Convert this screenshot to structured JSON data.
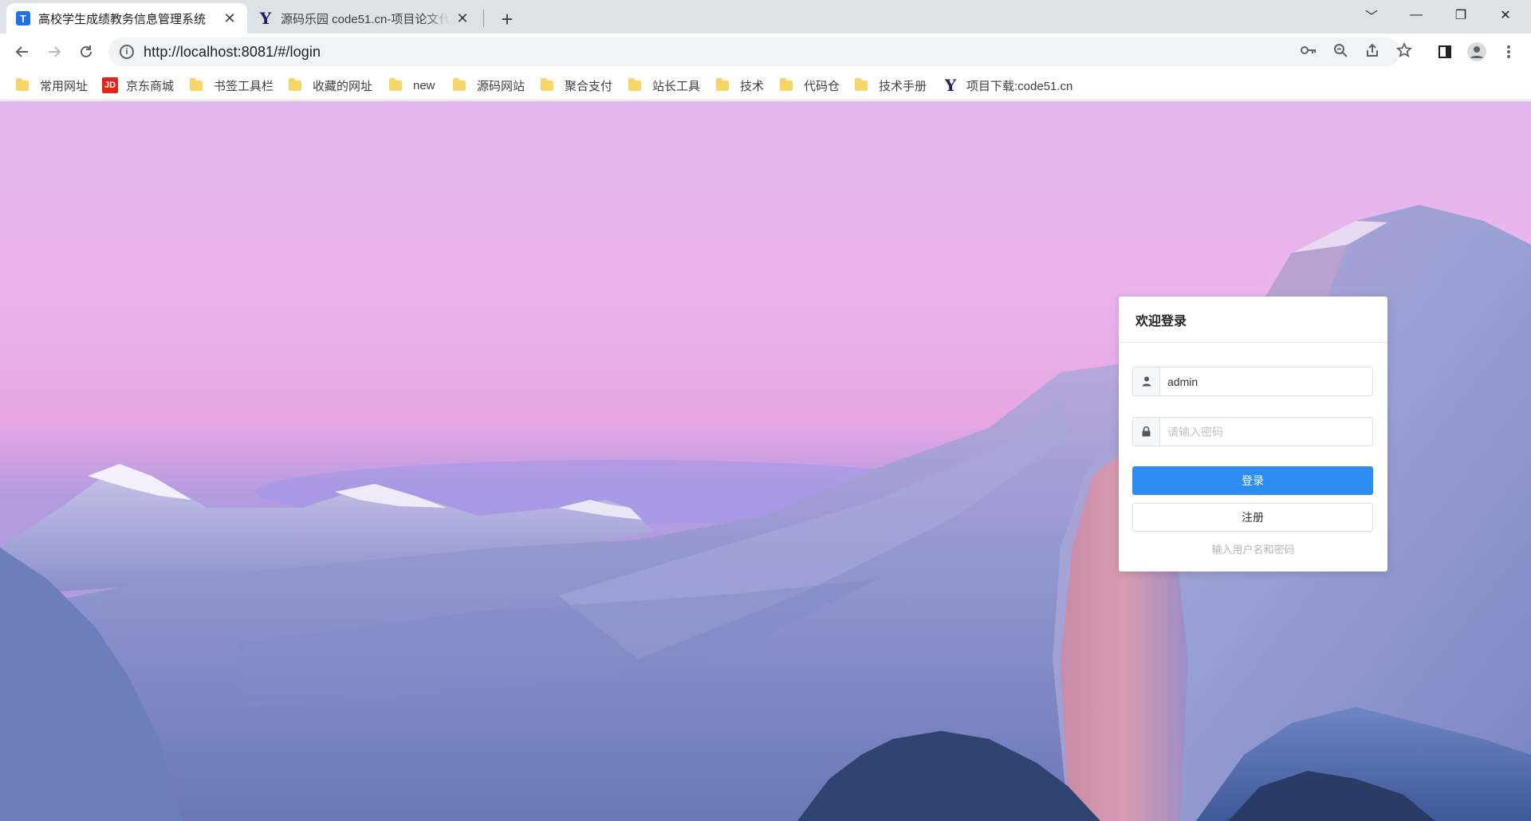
{
  "browser": {
    "tabs": [
      {
        "title": "高校学生成绩教务信息管理系统",
        "favicon": "T",
        "active": true
      },
      {
        "title": "源码乐园 code51.cn-项目论文代",
        "favicon": "Y",
        "active": false
      }
    ],
    "new_tab": "+",
    "url": "http://localhost:8081/#/login",
    "window_controls": {
      "tab_search": "﹀",
      "minimize": "—",
      "restore": "❐",
      "close": "✕"
    }
  },
  "bookmarks": [
    {
      "label": "常用网址",
      "icon": "folder-icon"
    },
    {
      "label": "京东商城",
      "icon": "jd-icon",
      "icon_text": "JD"
    },
    {
      "label": "书签工具栏",
      "icon": "folder-icon"
    },
    {
      "label": "收藏的网址",
      "icon": "folder-icon"
    },
    {
      "label": "new",
      "icon": "folder-icon"
    },
    {
      "label": "源码网站",
      "icon": "folder-icon"
    },
    {
      "label": "聚合支付",
      "icon": "folder-icon"
    },
    {
      "label": "站长工具",
      "icon": "folder-icon"
    },
    {
      "label": "技术",
      "icon": "folder-icon"
    },
    {
      "label": "代码仓",
      "icon": "folder-icon"
    },
    {
      "label": "技术手册",
      "icon": "folder-icon"
    },
    {
      "label": "项目下载:code51.cn",
      "icon": "y-logo-icon",
      "icon_text": "Y"
    }
  ],
  "login": {
    "title": "欢迎登录",
    "username_value": "admin",
    "username_icon": "user-icon",
    "password_placeholder": "请输入密码",
    "password_icon": "lock-icon",
    "login_button": "登录",
    "register_button": "注册",
    "hint": "输入用户名和密码",
    "primary_color": "#2d8cf0"
  }
}
